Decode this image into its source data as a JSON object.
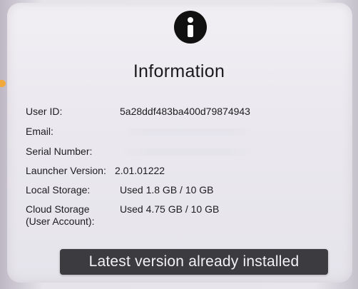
{
  "dialog": {
    "icon": "info-icon",
    "title": "Information"
  },
  "fields": {
    "user_id_label": "User ID:",
    "user_id_value": "5a28ddf483ba400d79874943",
    "email_label": "Email:",
    "serial_label": "Serial Number:",
    "launcher_label": "Launcher Version:",
    "launcher_value": "2.01.01222",
    "local_storage_label": "Local Storage:",
    "local_storage_value": "Used 1.8 GB / 10 GB",
    "cloud_storage_label_line1": "Cloud Storage",
    "cloud_storage_label_line2": "(User Account):",
    "cloud_storage_value": "Used 4.75 GB / 10 GB"
  },
  "toast": {
    "message": "Latest version already installed"
  },
  "colors": {
    "screen_bg": "#ebe9ef",
    "toast_bg": "#3c3b40",
    "accent_dot": "#f2a93b"
  }
}
